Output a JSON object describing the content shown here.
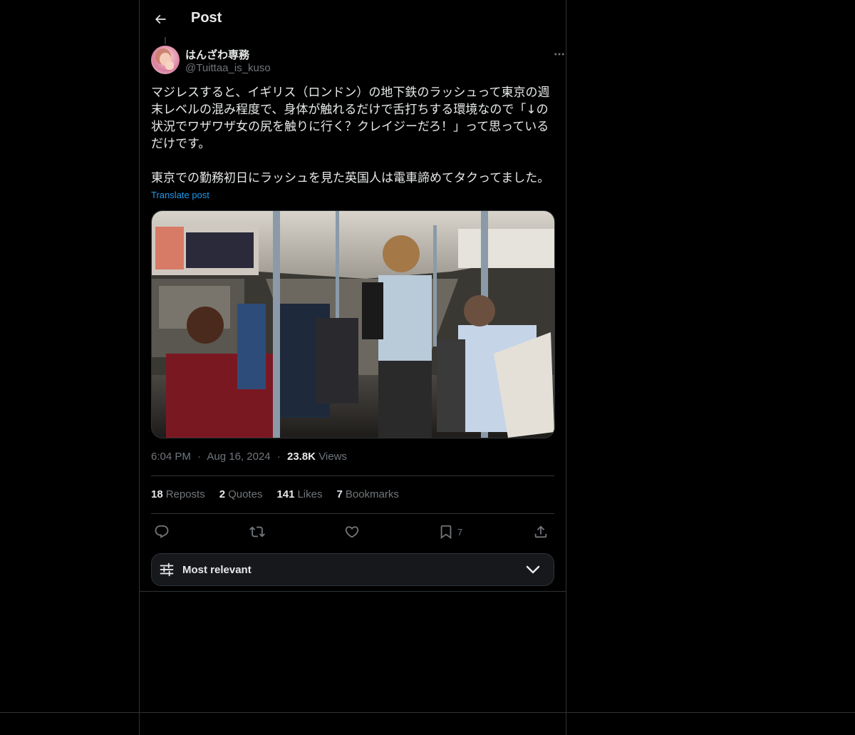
{
  "header": {
    "title": "Post",
    "back_icon": "arrow-left-icon"
  },
  "post": {
    "author": {
      "display_name": "はんざわ専務",
      "handle": "@Tuittaa_is_kuso"
    },
    "more_icon": "more-horizontal-icon",
    "text": "マジレスすると、イギリス（ロンドン）の地下鉄のラッシュって東京の週末レベルの混み程度で、身体が触れるだけで舌打ちする環境なので「↓の状況でワザワザ女の尻を触りに行く？クレイジーだろ！」って思っているだけです。\n\n東京での勤務初日にラッシュを見た英国人は電車諦めてタクってました。",
    "translate_label": "Translate post",
    "media_description": "photo",
    "time": "6:04 PM",
    "date": "Aug 16, 2024",
    "views_count": "23.8K",
    "views_label": "Views",
    "separator": "·",
    "stats": {
      "reposts_count": "18",
      "reposts_label": "Reposts",
      "quotes_count": "2",
      "quotes_label": "Quotes",
      "likes_count": "141",
      "likes_label": "Likes",
      "bookmarks_count": "7",
      "bookmarks_label": "Bookmarks"
    },
    "actions": {
      "reply_icon": "reply-icon",
      "repost_icon": "repost-icon",
      "like_icon": "heart-icon",
      "bookmark_icon": "bookmark-icon",
      "bookmark_count": "7",
      "share_icon": "share-icon"
    }
  },
  "sort": {
    "label": "Most relevant",
    "icon": "sliders-icon",
    "chevron": "chevron-down-icon"
  },
  "colors": {
    "background": "#000000",
    "text": "#e7e9ea",
    "muted": "#71767b",
    "accent": "#1d9bf0",
    "border": "#2f3336"
  }
}
